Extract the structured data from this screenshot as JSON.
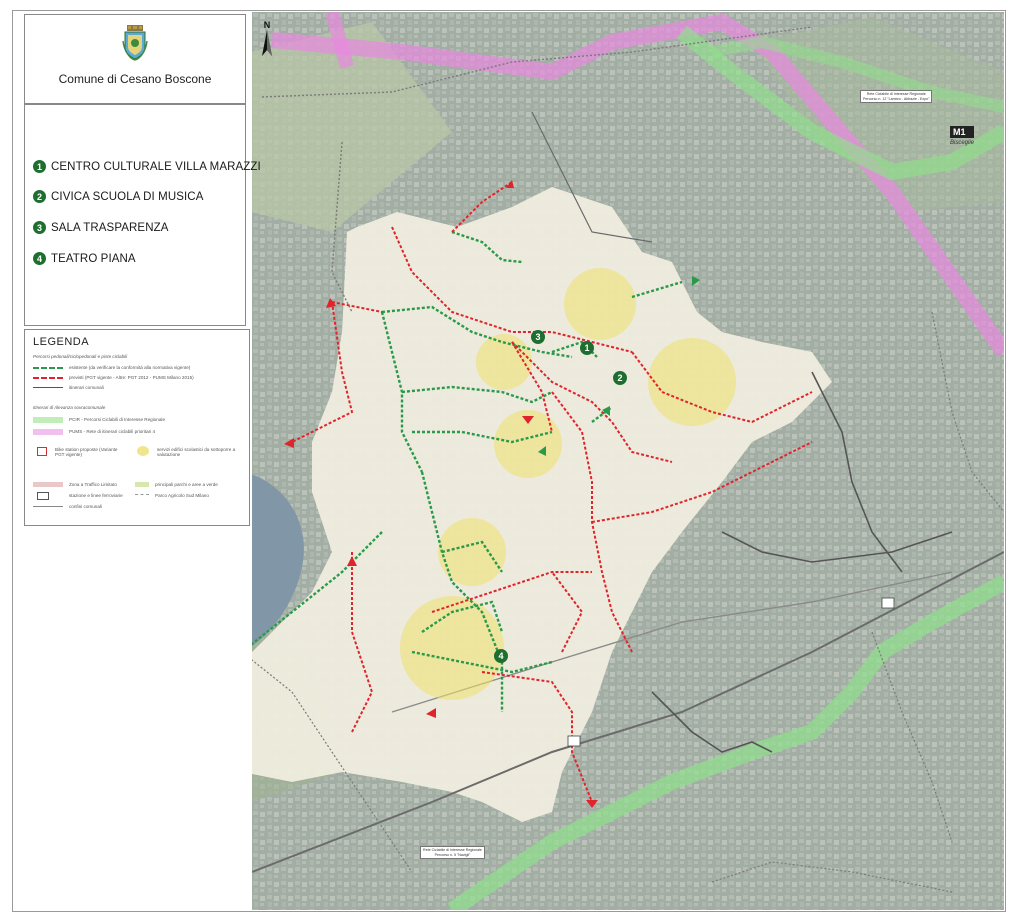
{
  "header": {
    "municipality": "Comune di Cesano Boscone",
    "coat_of_arms": "coat-of-arms-icon"
  },
  "venues": [
    {
      "number": "1",
      "name": "CENTRO CULTURALE VILLA MARAZZI"
    },
    {
      "number": "2",
      "name": "CIVICA SCUOLA DI MUSICA"
    },
    {
      "number": "3",
      "name": "SALA TRASPARENZA"
    },
    {
      "number": "4",
      "name": "TEATRO PIANA"
    }
  ],
  "legend": {
    "title": "LEGENDA",
    "section_paths": "Percorsi pedonali/ciclopedonali e piste ciclabili",
    "item_existing": "esistente (da verificare la conformità alla normativa vigente)",
    "item_planned": "previsti (PGT vigente - Altre: PGT 2012 - PUMS Milano 2015)",
    "item_other": "itinerari comunali",
    "section_relevance": "Itinerari di rilevanza sovracomunale",
    "item_pcir": "PCIR - Percorsi Ciclabili di Interesse Regionale",
    "item_pums": "PUMS - Rete di itinerari ciclabili prioritari 4",
    "item_bike_station": "Bike station proposte (Variante PGT vigente)",
    "item_buildings": "servizi edifici scolastici da sottoporre a valutazione",
    "item_ztl": "Zona a Traffico Limitato",
    "item_parking": "stazione e linee ferroviarie",
    "item_green": "principali parchi e aree a verde",
    "item_park": "Parco Agricolo Sud Milano",
    "item_boundary": "confini comunali"
  },
  "map_labels": {
    "metro_code": "M1",
    "metro_station": "Bisceglie",
    "pcir_top_line1": "Rete Ciclabile di Interesse Regionale",
    "pcir_top_line2": "Percorso n. 12 \"Lambro - Abbazie - Expo\"",
    "pcir_bottom_line1": "Rete Ciclabile di Interesse Regionale",
    "pcir_bottom_line2": "Percorso n. 5 \"Navigli\"",
    "north": "N",
    "venue_markers": [
      "1",
      "2",
      "3",
      "4"
    ]
  },
  "colors": {
    "existing_path": "#2a9a4a",
    "planned_path": "#e0242c",
    "pums": "#e889e0",
    "pcir": "#8fe08a",
    "buffer": "#efe06a",
    "venue": "#1e6f2f"
  }
}
